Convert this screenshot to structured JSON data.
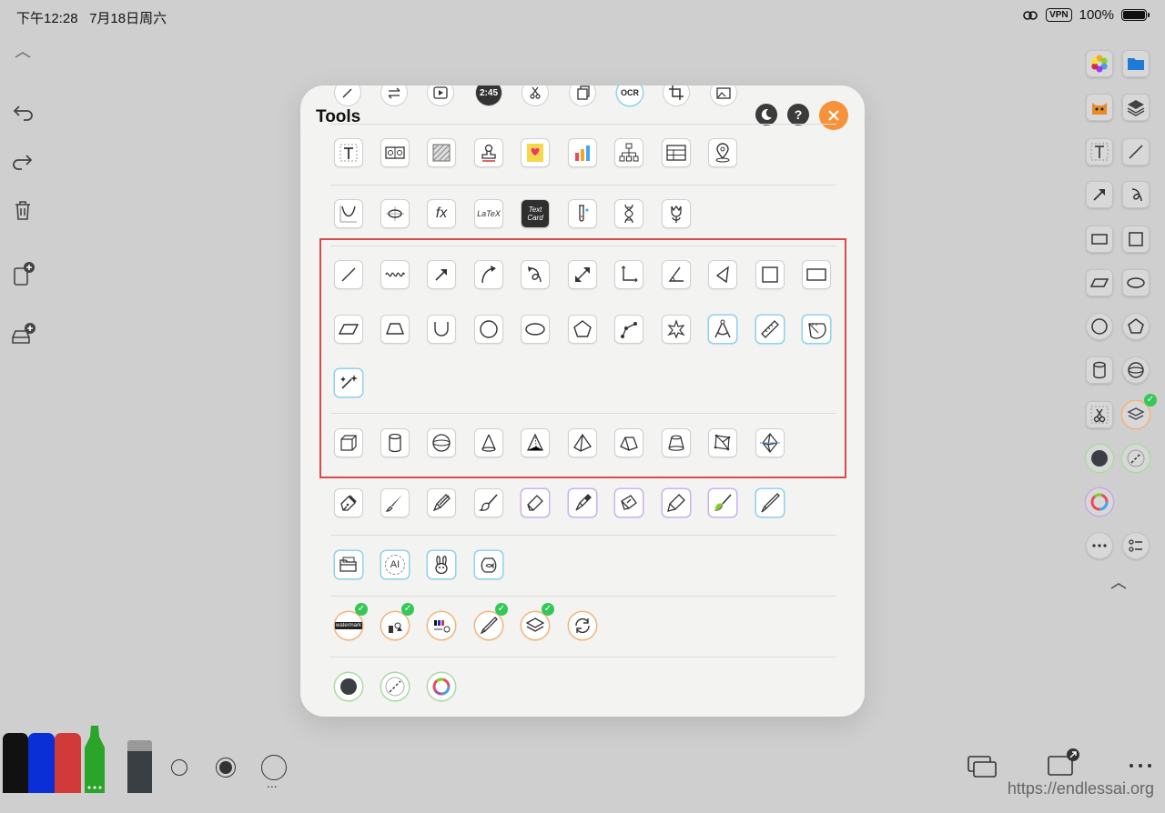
{
  "status": {
    "time": "下午12:28",
    "date": "7月18日周六",
    "vpn": "VPN",
    "battery": "100%"
  },
  "panel": {
    "title": "Tools",
    "top_timer": "2:45",
    "top_ocr": "OCR"
  },
  "tools": {
    "text_card_label": "Text Card",
    "latex_label": "LaTeX",
    "fx_label": "fx",
    "ai_label": "AI",
    "watermark_label": "watermark",
    "autodraw_label": "Auto Draw"
  },
  "bottom": {
    "dots": "...",
    "watermark_url": "https://endlessai.org"
  },
  "colors": {
    "accent_orange": "#f7923a",
    "green_check": "#34c759",
    "highlight_red": "#e04848",
    "marker_black": "#111111",
    "marker_blue": "#0b2fd6",
    "marker_red": "#d23a3a",
    "marker_green": "#2aa52a"
  }
}
